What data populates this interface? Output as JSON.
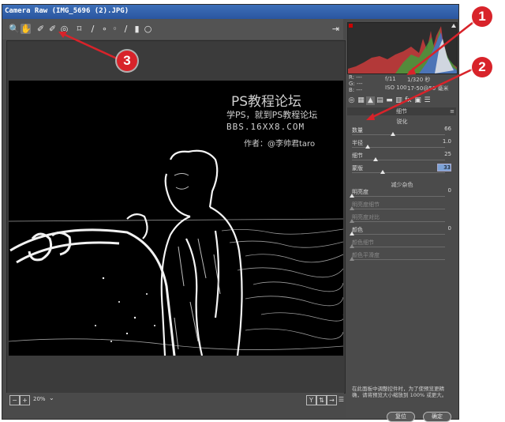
{
  "window": {
    "title": "Camera Raw (IMG_5696 (2).JPG)"
  },
  "toolbar": {
    "tools": [
      "zoom-icon",
      "hand-icon",
      "white-balance-icon",
      "color-sampler-icon",
      "targeted-adjust-icon",
      "crop-icon",
      "straighten-icon",
      "spot-removal-icon",
      "red-eye-icon",
      "adjustment-brush-icon",
      "graduated-filter-icon",
      "radial-filter-icon"
    ],
    "open_prefs_icon": "preferences-icon"
  },
  "watermark": {
    "line1": "PS教程论坛",
    "line2": "学PS，就到PS教程论坛",
    "line3": "BBS.16XX8.COM",
    "line4": "作者：@李帅君taro"
  },
  "status": {
    "zoom": "20%"
  },
  "camera_info": {
    "r": "R: ---",
    "g": "G: ---",
    "b": "B: ---",
    "aperture": "f/11",
    "shutter": "1/320 秒",
    "iso": "ISO 100",
    "lens": "17-50@50 毫米"
  },
  "panel": {
    "title": "细节",
    "sharpen_title": "锐化",
    "sharpen": [
      {
        "label": "数量",
        "value": "66",
        "fraction": 0.44
      },
      {
        "label": "半径",
        "value": "1.0",
        "fraction": 0.17
      },
      {
        "label": "细节",
        "value": "25",
        "fraction": 0.25
      },
      {
        "label": "蒙版",
        "value": "33",
        "fraction": 0.33,
        "highlight": true
      }
    ],
    "noise_title": "减少杂色",
    "noise": [
      {
        "label": "明亮度",
        "value": "0",
        "fraction": 0.0
      },
      {
        "label": "明亮度细节",
        "value": "",
        "fraction": 0.0,
        "disabled": true
      },
      {
        "label": "明亮度对比",
        "value": "",
        "fraction": 0.0,
        "disabled": true
      },
      {
        "label": "颜色",
        "value": "0",
        "fraction": 0.0
      },
      {
        "label": "颜色细节",
        "value": "",
        "fraction": 0.0,
        "disabled": true
      },
      {
        "label": "颜色平滑度",
        "value": "",
        "fraction": 0.0,
        "disabled": true
      }
    ],
    "note": "在此面板中调整控件时，为了使预览更精确，请将预览大小缩放到 100% 或更大。"
  },
  "buttons": {
    "cancel": "复位",
    "ok": "确定"
  },
  "callouts": [
    "1",
    "2",
    "3"
  ],
  "colors": {
    "callout": "#d8232a",
    "titlebar": "#2a56a0"
  }
}
